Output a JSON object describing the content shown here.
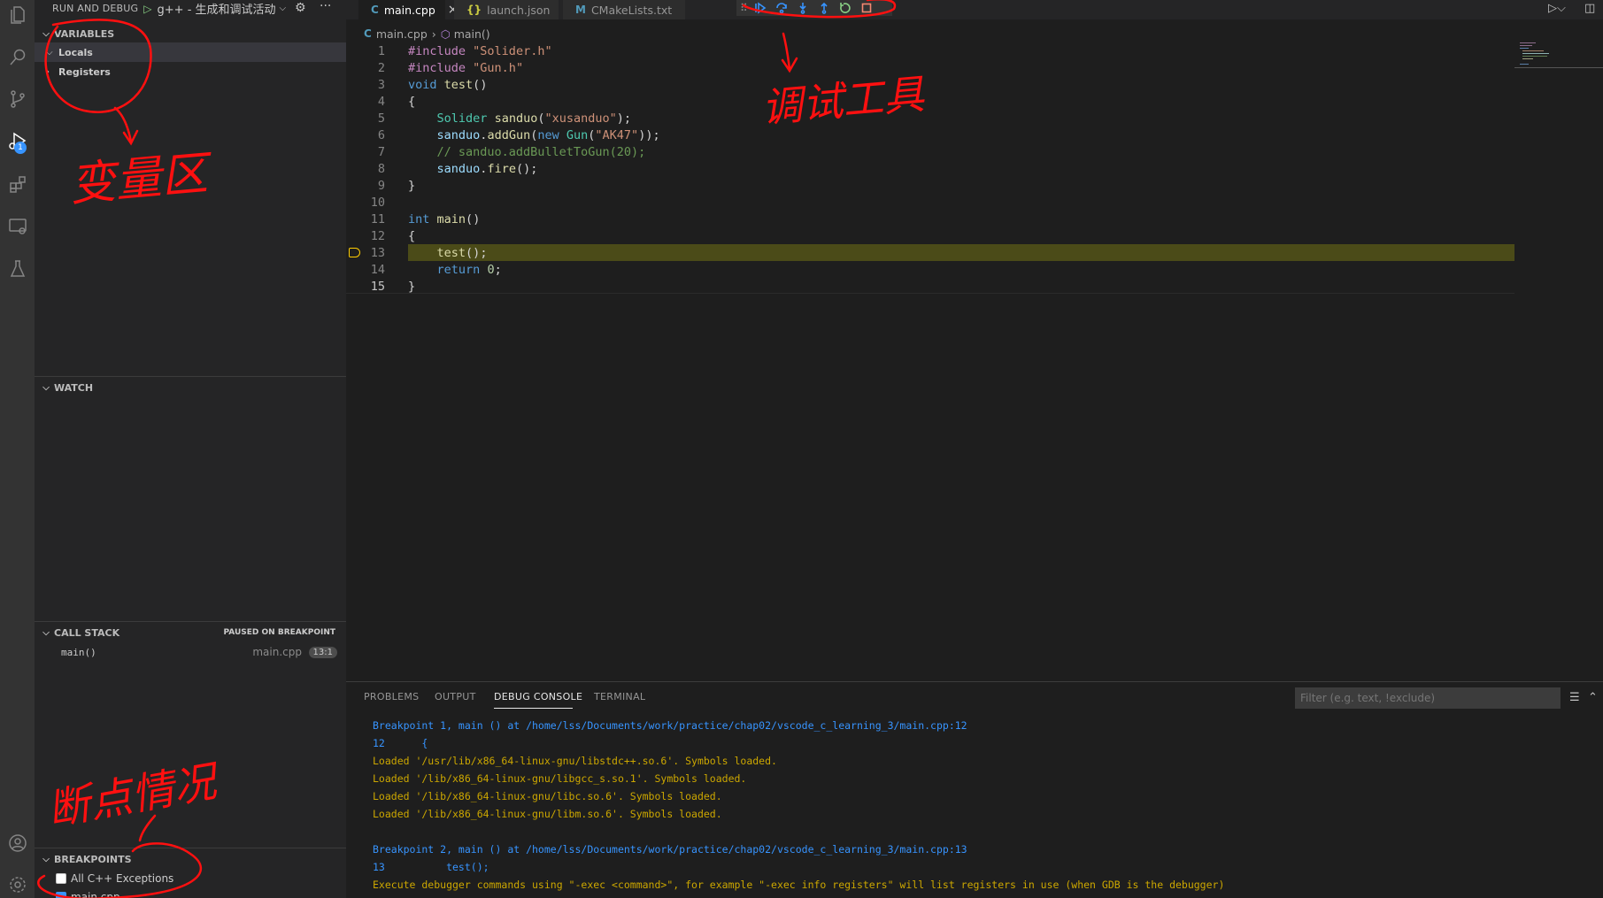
{
  "run_debug": {
    "title": "RUN AND DEBUG",
    "config": "g++ - 生成和调试活动"
  },
  "activity_bar": {
    "debug_badge": "1",
    "icons": [
      "files-icon",
      "search-icon",
      "source-control-icon",
      "run-debug-icon",
      "extensions-icon",
      "remote-explorer-icon",
      "testing-icon",
      "account-icon",
      "settings-gear-icon"
    ]
  },
  "variables": {
    "header": "VARIABLES",
    "items": [
      "Locals",
      "Registers"
    ]
  },
  "watch": {
    "header": "WATCH"
  },
  "call_stack": {
    "header": "CALL STACK",
    "status": "PAUSED ON BREAKPOINT",
    "frame": {
      "name": "main()",
      "file": "main.cpp",
      "position": "13:1"
    }
  },
  "breakpoints": {
    "header": "BREAKPOINTS",
    "items": [
      {
        "label": "All C++ Exceptions",
        "checked": false
      },
      {
        "label": "main.cpp",
        "checked": true
      }
    ]
  },
  "tabs": [
    {
      "label": "main.cpp",
      "icon": "C",
      "active": true
    },
    {
      "label": "launch.json",
      "icon": "{}",
      "active": false
    },
    {
      "label": "CMakeLists.txt",
      "icon": "M",
      "active": false
    }
  ],
  "breadcrumb": {
    "file": "main.cpp",
    "symbol": "main()"
  },
  "editor": {
    "current_line": 13,
    "lines": [
      "#include \"Solider.h\"",
      "#include \"Gun.h\"",
      "void test()",
      "{",
      "    Solider sanduo(\"xusanduo\");",
      "    sanduo.addGun(new Gun(\"AK47\"));",
      "    // sanduo.addBulletToGun(20);",
      "    sanduo.fire();",
      "}",
      "",
      "int main()",
      "{",
      "    test();",
      "    return 0;",
      "}"
    ]
  },
  "panel": {
    "tabs": [
      "PROBLEMS",
      "OUTPUT",
      "DEBUG CONSOLE",
      "TERMINAL"
    ],
    "active_tab": "DEBUG CONSOLE",
    "filter_placeholder": "Filter (e.g. text, !exclude)",
    "console": [
      {
        "text": "Breakpoint 1, main () at /home/lss/Documents/work/practice/chap02/vscode_c_learning_3/main.cpp:12",
        "color": "blue"
      },
      {
        "text": "12\t{",
        "color": "blue"
      },
      {
        "text": "Loaded '/usr/lib/x86_64-linux-gnu/libstdc++.so.6'. Symbols loaded.",
        "color": "yellow"
      },
      {
        "text": "Loaded '/lib/x86_64-linux-gnu/libgcc_s.so.1'. Symbols loaded.",
        "color": "yellow"
      },
      {
        "text": "Loaded '/lib/x86_64-linux-gnu/libc.so.6'. Symbols loaded.",
        "color": "yellow"
      },
      {
        "text": "Loaded '/lib/x86_64-linux-gnu/libm.so.6'. Symbols loaded.",
        "color": "yellow"
      },
      {
        "text": "",
        "color": "yellow"
      },
      {
        "text": "Breakpoint 2, main () at /home/lss/Documents/work/practice/chap02/vscode_c_learning_3/main.cpp:13",
        "color": "blue"
      },
      {
        "text": "13\t    test();",
        "color": "blue"
      },
      {
        "text": "Execute debugger commands using \"-exec <command>\", for example \"-exec info registers\" will list registers in use (when GDB is the debugger)",
        "color": "yellow"
      }
    ]
  },
  "annotations": {
    "variables_area": "变量区",
    "debug_toolbar": "调试工具",
    "breakpoint_status": "断点情况"
  },
  "colors": {
    "current_line_bg": "#4b4b18",
    "breakpoint_arrow": "#ffcc00",
    "annotation": "#ff1010",
    "console_blue": "#3794ff",
    "console_yellow": "#cca700"
  }
}
